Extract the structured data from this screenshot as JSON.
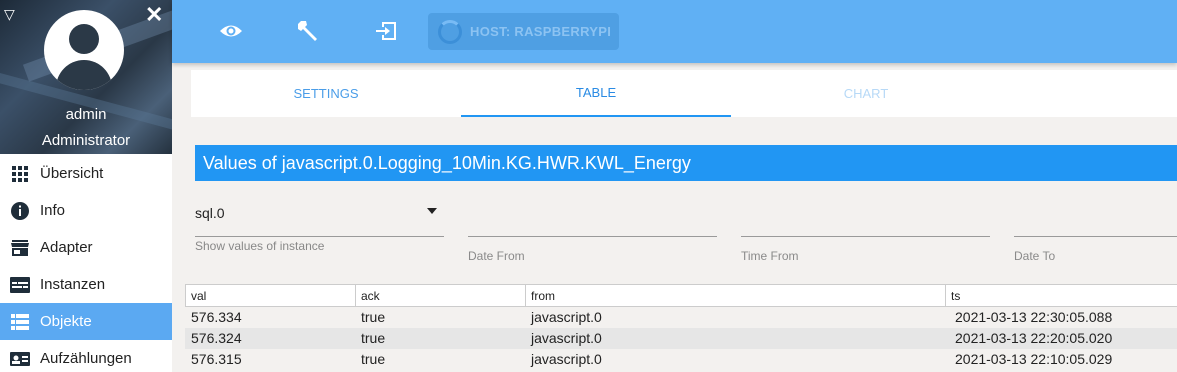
{
  "sidebar": {
    "profile": {
      "name": "admin",
      "role": "Administrator"
    },
    "items": [
      {
        "label": "Übersicht",
        "icon": "grid-icon",
        "active": false
      },
      {
        "label": "Info",
        "icon": "info-icon",
        "active": false
      },
      {
        "label": "Adapter",
        "icon": "store-icon",
        "active": false
      },
      {
        "label": "Instanzen",
        "icon": "instances-icon",
        "active": false
      },
      {
        "label": "Objekte",
        "icon": "list-icon",
        "active": true
      },
      {
        "label": "Aufzählungen",
        "icon": "card-icon",
        "active": false
      }
    ]
  },
  "topbar": {
    "host_label": "HOST: RASPBERRYPI",
    "icons": [
      "eye-icon",
      "wrench-icon",
      "logout-icon"
    ]
  },
  "tabs": [
    {
      "label": "SETTINGS"
    },
    {
      "label": "TABLE"
    },
    {
      "label": "CHART"
    }
  ],
  "title": "Values of javascript.0.Logging_10Min.KG.HWR.KWL_Energy",
  "form": {
    "instance_value": "sql.0",
    "instance_helper": "Show values of instance",
    "date_from": "Date From",
    "time_from": "Time From",
    "date_to": "Date To"
  },
  "table": {
    "columns": [
      "val",
      "ack",
      "from",
      "ts"
    ],
    "rows": [
      [
        "576.334",
        "true",
        "javascript.0",
        "2021-03-13 22:30:05.088"
      ],
      [
        "576.324",
        "true",
        "javascript.0",
        "2021-03-13 22:20:05.020"
      ],
      [
        "576.315",
        "true",
        "javascript.0",
        "2021-03-13 22:10:05.029"
      ]
    ]
  },
  "colors": {
    "topbar": "#60b0f4",
    "accent": "#2196f3",
    "active_nav": "#5ba9f2"
  }
}
